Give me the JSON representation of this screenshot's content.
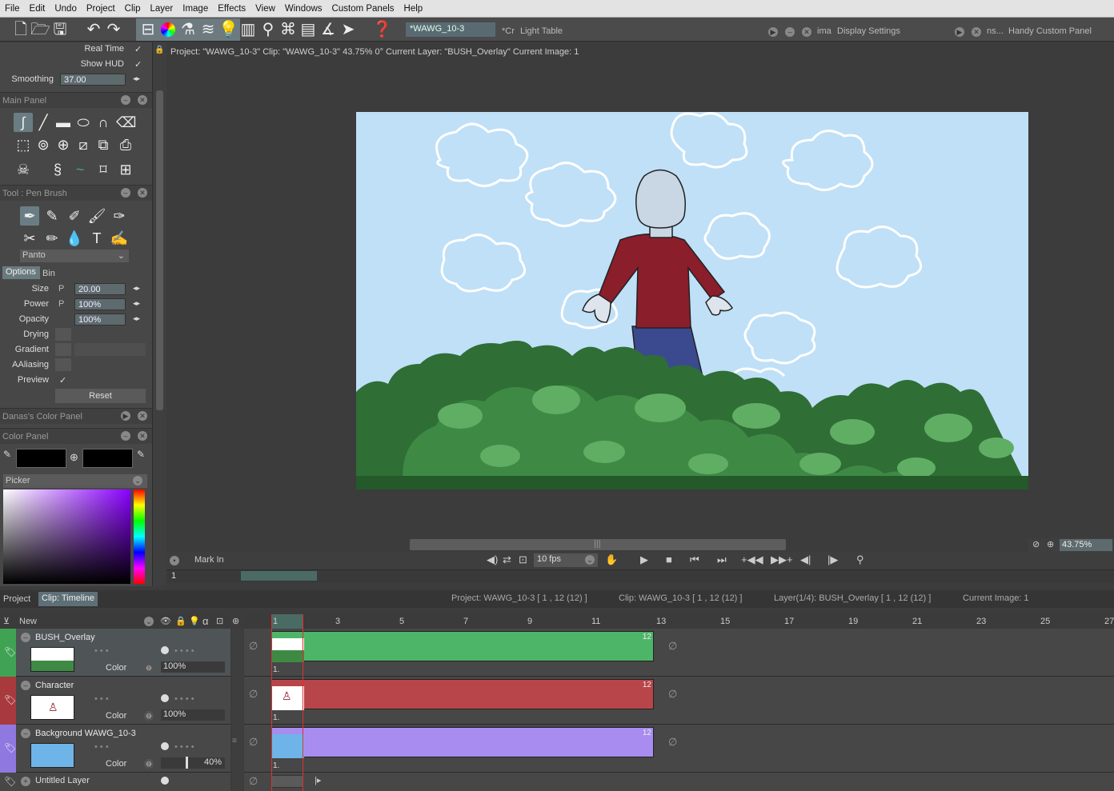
{
  "menu": [
    "File",
    "Edit",
    "Undo",
    "Project",
    "Clip",
    "Layer",
    "Image",
    "Effects",
    "View",
    "Windows",
    "Custom Panels",
    "Help"
  ],
  "tabs": {
    "active_doc": "*WAWG_10-3",
    "cr": "*Cr",
    "light_table": "Light Table",
    "ima": "ima",
    "display_settings": "Display Settings",
    "ns": "ns...",
    "handy": "Handy Custom Panel"
  },
  "settings": {
    "real_time": "Real Time",
    "show_hud": "Show HUD",
    "smoothing_label": "Smoothing",
    "smoothing_value": "37.00"
  },
  "main_panel": {
    "title": "Main Panel"
  },
  "tool_panel": {
    "title": "Tool : Pen Brush",
    "preset": "Panto",
    "tab_options": "Options",
    "tab_bin": "Bin",
    "size_label": "Size",
    "size_value": "20.00",
    "power_label": "Power",
    "power_value": "100%",
    "opacity_label": "Opacity",
    "opacity_value": "100%",
    "drying": "Drying",
    "gradient": "Gradient",
    "aaliasing": "AAliasing",
    "preview": "Preview",
    "reset": "Reset",
    "p": "P"
  },
  "color_panels": {
    "danas": "Danas's Color Panel",
    "color_panel": "Color Panel",
    "picker": "Picker"
  },
  "status": {
    "info": "Project: \"WAWG_10-3\"  Clip: \"WAWG_10-3\"   43.75%   0°  Current Layer: \"BUSH_Overlay\"  Current Image: 1"
  },
  "transport": {
    "mark_in": "Mark In",
    "fps": "10 fps",
    "zoom": "43.75%",
    "frame": "1"
  },
  "timeline": {
    "tab_project": "Project",
    "tab_clip": "Clip: Timeline",
    "project_info": "Project: WAWG_10-3 [ 1 , 12  (12) ]",
    "clip_info": "Clip: WAWG_10-3 [ 1 , 12  (12) ]",
    "layer_info": "Layer(1/4): BUSH_Overlay [ 1 , 12  (12) ]",
    "image_info": "Current Image: 1",
    "new_label": "New",
    "frame_numbers": [
      "1",
      "3",
      "5",
      "7",
      "9",
      "11",
      "13",
      "15",
      "17",
      "19",
      "21",
      "23",
      "25",
      "27"
    ],
    "layers": [
      {
        "name": "BUSH_Overlay",
        "color_label": "Color",
        "opacity": "100%",
        "end": "12",
        "marker": "1."
      },
      {
        "name": "Character",
        "color_label": "Color",
        "opacity": "100%",
        "end": "12",
        "marker": "1."
      },
      {
        "name": "Background WAWG_10-3",
        "color_label": "Color",
        "opacity": "40%",
        "end": "12",
        "marker": "1."
      }
    ],
    "untitled": "Untitled Layer"
  },
  "colors": {
    "green": "#4db568",
    "red": "#b8454a",
    "purple": "#a98cf0",
    "sky": "#bfe0f7",
    "shirt": "#8b1e2b",
    "pants": "#3b4a8e"
  }
}
